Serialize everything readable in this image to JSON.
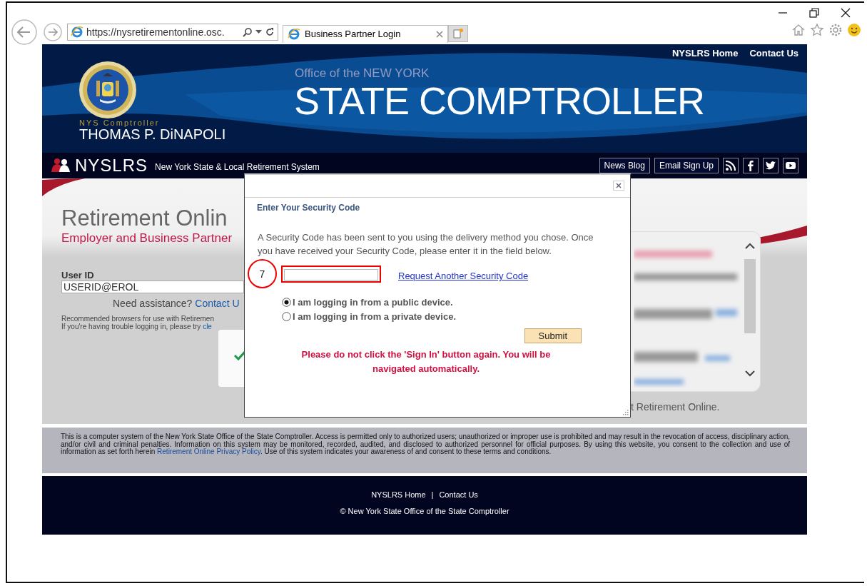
{
  "browser": {
    "address": "https://nysretirementonline.osc.",
    "tabs": [
      {
        "title": "Business Partner Login",
        "selected": true
      }
    ]
  },
  "header": {
    "links": [
      "NYSLRS Home",
      "Contact Us"
    ],
    "comptroller_label": "NYS Comptroller",
    "comptroller_name": "THOMAS P. DiNAPOLI",
    "office_line": "Office of the NEW YORK",
    "office_title": "STATE COMPTROLLER"
  },
  "navbar": {
    "brand": "NYSLRS",
    "system_name": "New York State & Local Retirement System",
    "buttons": [
      "News Blog",
      "Email Sign Up"
    ]
  },
  "login": {
    "title": "Retirement Onlin",
    "subtitle": "Employer and Business Partner",
    "user_id_label": "User ID",
    "user_id_value": "USERID@EROL",
    "assistance": "Need assistance?",
    "assistance_link": "Contact U",
    "browsers_note": "Recommended browsers for use with Retiremen",
    "trouble_note": "If you're having trouble logging in, please try ",
    "trouble_link": "cle"
  },
  "side_panel": {
    "caption": "t Retirement Online."
  },
  "dialog": {
    "title": "Enter Your Security Code",
    "message": "A Security Code has been sent to you using the delivery method you chose. Once you have received your Security Code, please enter it in the field below.",
    "request_link": "Request Another Security Code",
    "options": [
      {
        "label": "I am logging in from a public device.",
        "selected": true
      },
      {
        "label": "I am logging in from a private device.",
        "selected": false
      }
    ],
    "submit": "Submit",
    "warning": "Please do not click the 'Sign In' button again. You will be navigated automatically."
  },
  "annotation": {
    "step": "7"
  },
  "disclaimer": {
    "text_before": "This is a computer system of the New York State Office of the State Comptroller. Access is permitted only to authorized users; unauthorized or improper use is prohibited and may result in the revocation of access, disciplinary action, and/or civil and criminal penalties. Information on this system may be monitored, recorded, audited, and disclosed to authorized personnel for official purposes. By using this website, you consent to the collection and use of information as set forth herein ",
    "link": "Retirement Online Privacy Policy",
    "text_after": ". Use of this system indicates your awareness of and consent to these terms and conditions."
  },
  "footer": {
    "links": [
      "NYSLRS Home",
      "Contact Us"
    ],
    "separator": "|",
    "copyright": "© New York State Office of the State Comptroller"
  }
}
